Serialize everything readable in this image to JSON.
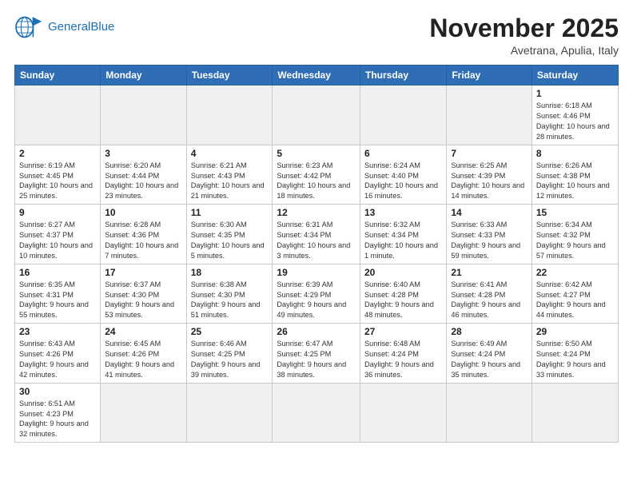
{
  "header": {
    "logo_general": "General",
    "logo_blue": "Blue",
    "month_title": "November 2025",
    "location": "Avetrana, Apulia, Italy"
  },
  "days_of_week": [
    "Sunday",
    "Monday",
    "Tuesday",
    "Wednesday",
    "Thursday",
    "Friday",
    "Saturday"
  ],
  "weeks": [
    [
      {
        "day": "",
        "info": ""
      },
      {
        "day": "",
        "info": ""
      },
      {
        "day": "",
        "info": ""
      },
      {
        "day": "",
        "info": ""
      },
      {
        "day": "",
        "info": ""
      },
      {
        "day": "",
        "info": ""
      },
      {
        "day": "1",
        "info": "Sunrise: 6:18 AM\nSunset: 4:46 PM\nDaylight: 10 hours and 28 minutes."
      }
    ],
    [
      {
        "day": "2",
        "info": "Sunrise: 6:19 AM\nSunset: 4:45 PM\nDaylight: 10 hours and 25 minutes."
      },
      {
        "day": "3",
        "info": "Sunrise: 6:20 AM\nSunset: 4:44 PM\nDaylight: 10 hours and 23 minutes."
      },
      {
        "day": "4",
        "info": "Sunrise: 6:21 AM\nSunset: 4:43 PM\nDaylight: 10 hours and 21 minutes."
      },
      {
        "day": "5",
        "info": "Sunrise: 6:23 AM\nSunset: 4:42 PM\nDaylight: 10 hours and 18 minutes."
      },
      {
        "day": "6",
        "info": "Sunrise: 6:24 AM\nSunset: 4:40 PM\nDaylight: 10 hours and 16 minutes."
      },
      {
        "day": "7",
        "info": "Sunrise: 6:25 AM\nSunset: 4:39 PM\nDaylight: 10 hours and 14 minutes."
      },
      {
        "day": "8",
        "info": "Sunrise: 6:26 AM\nSunset: 4:38 PM\nDaylight: 10 hours and 12 minutes."
      }
    ],
    [
      {
        "day": "9",
        "info": "Sunrise: 6:27 AM\nSunset: 4:37 PM\nDaylight: 10 hours and 10 minutes."
      },
      {
        "day": "10",
        "info": "Sunrise: 6:28 AM\nSunset: 4:36 PM\nDaylight: 10 hours and 7 minutes."
      },
      {
        "day": "11",
        "info": "Sunrise: 6:30 AM\nSunset: 4:35 PM\nDaylight: 10 hours and 5 minutes."
      },
      {
        "day": "12",
        "info": "Sunrise: 6:31 AM\nSunset: 4:34 PM\nDaylight: 10 hours and 3 minutes."
      },
      {
        "day": "13",
        "info": "Sunrise: 6:32 AM\nSunset: 4:34 PM\nDaylight: 10 hours and 1 minute."
      },
      {
        "day": "14",
        "info": "Sunrise: 6:33 AM\nSunset: 4:33 PM\nDaylight: 9 hours and 59 minutes."
      },
      {
        "day": "15",
        "info": "Sunrise: 6:34 AM\nSunset: 4:32 PM\nDaylight: 9 hours and 57 minutes."
      }
    ],
    [
      {
        "day": "16",
        "info": "Sunrise: 6:35 AM\nSunset: 4:31 PM\nDaylight: 9 hours and 55 minutes."
      },
      {
        "day": "17",
        "info": "Sunrise: 6:37 AM\nSunset: 4:30 PM\nDaylight: 9 hours and 53 minutes."
      },
      {
        "day": "18",
        "info": "Sunrise: 6:38 AM\nSunset: 4:30 PM\nDaylight: 9 hours and 51 minutes."
      },
      {
        "day": "19",
        "info": "Sunrise: 6:39 AM\nSunset: 4:29 PM\nDaylight: 9 hours and 49 minutes."
      },
      {
        "day": "20",
        "info": "Sunrise: 6:40 AM\nSunset: 4:28 PM\nDaylight: 9 hours and 48 minutes."
      },
      {
        "day": "21",
        "info": "Sunrise: 6:41 AM\nSunset: 4:28 PM\nDaylight: 9 hours and 46 minutes."
      },
      {
        "day": "22",
        "info": "Sunrise: 6:42 AM\nSunset: 4:27 PM\nDaylight: 9 hours and 44 minutes."
      }
    ],
    [
      {
        "day": "23",
        "info": "Sunrise: 6:43 AM\nSunset: 4:26 PM\nDaylight: 9 hours and 42 minutes."
      },
      {
        "day": "24",
        "info": "Sunrise: 6:45 AM\nSunset: 4:26 PM\nDaylight: 9 hours and 41 minutes."
      },
      {
        "day": "25",
        "info": "Sunrise: 6:46 AM\nSunset: 4:25 PM\nDaylight: 9 hours and 39 minutes."
      },
      {
        "day": "26",
        "info": "Sunrise: 6:47 AM\nSunset: 4:25 PM\nDaylight: 9 hours and 38 minutes."
      },
      {
        "day": "27",
        "info": "Sunrise: 6:48 AM\nSunset: 4:24 PM\nDaylight: 9 hours and 36 minutes."
      },
      {
        "day": "28",
        "info": "Sunrise: 6:49 AM\nSunset: 4:24 PM\nDaylight: 9 hours and 35 minutes."
      },
      {
        "day": "29",
        "info": "Sunrise: 6:50 AM\nSunset: 4:24 PM\nDaylight: 9 hours and 33 minutes."
      }
    ],
    [
      {
        "day": "30",
        "info": "Sunrise: 6:51 AM\nSunset: 4:23 PM\nDaylight: 9 hours and 32 minutes."
      },
      {
        "day": "",
        "info": ""
      },
      {
        "day": "",
        "info": ""
      },
      {
        "day": "",
        "info": ""
      },
      {
        "day": "",
        "info": ""
      },
      {
        "day": "",
        "info": ""
      },
      {
        "day": "",
        "info": ""
      }
    ]
  ]
}
